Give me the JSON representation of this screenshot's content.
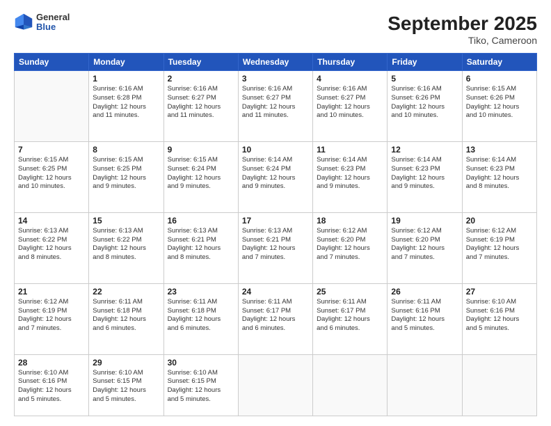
{
  "header": {
    "logo_general": "General",
    "logo_blue": "Blue",
    "month": "September 2025",
    "location": "Tiko, Cameroon"
  },
  "days_of_week": [
    "Sunday",
    "Monday",
    "Tuesday",
    "Wednesday",
    "Thursday",
    "Friday",
    "Saturday"
  ],
  "weeks": [
    [
      {
        "day": "",
        "text": ""
      },
      {
        "day": "1",
        "text": "Sunrise: 6:16 AM\nSunset: 6:28 PM\nDaylight: 12 hours\nand 11 minutes."
      },
      {
        "day": "2",
        "text": "Sunrise: 6:16 AM\nSunset: 6:27 PM\nDaylight: 12 hours\nand 11 minutes."
      },
      {
        "day": "3",
        "text": "Sunrise: 6:16 AM\nSunset: 6:27 PM\nDaylight: 12 hours\nand 11 minutes."
      },
      {
        "day": "4",
        "text": "Sunrise: 6:16 AM\nSunset: 6:27 PM\nDaylight: 12 hours\nand 10 minutes."
      },
      {
        "day": "5",
        "text": "Sunrise: 6:16 AM\nSunset: 6:26 PM\nDaylight: 12 hours\nand 10 minutes."
      },
      {
        "day": "6",
        "text": "Sunrise: 6:15 AM\nSunset: 6:26 PM\nDaylight: 12 hours\nand 10 minutes."
      }
    ],
    [
      {
        "day": "7",
        "text": "Sunrise: 6:15 AM\nSunset: 6:25 PM\nDaylight: 12 hours\nand 10 minutes."
      },
      {
        "day": "8",
        "text": "Sunrise: 6:15 AM\nSunset: 6:25 PM\nDaylight: 12 hours\nand 9 minutes."
      },
      {
        "day": "9",
        "text": "Sunrise: 6:15 AM\nSunset: 6:24 PM\nDaylight: 12 hours\nand 9 minutes."
      },
      {
        "day": "10",
        "text": "Sunrise: 6:14 AM\nSunset: 6:24 PM\nDaylight: 12 hours\nand 9 minutes."
      },
      {
        "day": "11",
        "text": "Sunrise: 6:14 AM\nSunset: 6:23 PM\nDaylight: 12 hours\nand 9 minutes."
      },
      {
        "day": "12",
        "text": "Sunrise: 6:14 AM\nSunset: 6:23 PM\nDaylight: 12 hours\nand 9 minutes."
      },
      {
        "day": "13",
        "text": "Sunrise: 6:14 AM\nSunset: 6:23 PM\nDaylight: 12 hours\nand 8 minutes."
      }
    ],
    [
      {
        "day": "14",
        "text": "Sunrise: 6:13 AM\nSunset: 6:22 PM\nDaylight: 12 hours\nand 8 minutes."
      },
      {
        "day": "15",
        "text": "Sunrise: 6:13 AM\nSunset: 6:22 PM\nDaylight: 12 hours\nand 8 minutes."
      },
      {
        "day": "16",
        "text": "Sunrise: 6:13 AM\nSunset: 6:21 PM\nDaylight: 12 hours\nand 8 minutes."
      },
      {
        "day": "17",
        "text": "Sunrise: 6:13 AM\nSunset: 6:21 PM\nDaylight: 12 hours\nand 7 minutes."
      },
      {
        "day": "18",
        "text": "Sunrise: 6:12 AM\nSunset: 6:20 PM\nDaylight: 12 hours\nand 7 minutes."
      },
      {
        "day": "19",
        "text": "Sunrise: 6:12 AM\nSunset: 6:20 PM\nDaylight: 12 hours\nand 7 minutes."
      },
      {
        "day": "20",
        "text": "Sunrise: 6:12 AM\nSunset: 6:19 PM\nDaylight: 12 hours\nand 7 minutes."
      }
    ],
    [
      {
        "day": "21",
        "text": "Sunrise: 6:12 AM\nSunset: 6:19 PM\nDaylight: 12 hours\nand 7 minutes."
      },
      {
        "day": "22",
        "text": "Sunrise: 6:11 AM\nSunset: 6:18 PM\nDaylight: 12 hours\nand 6 minutes."
      },
      {
        "day": "23",
        "text": "Sunrise: 6:11 AM\nSunset: 6:18 PM\nDaylight: 12 hours\nand 6 minutes."
      },
      {
        "day": "24",
        "text": "Sunrise: 6:11 AM\nSunset: 6:17 PM\nDaylight: 12 hours\nand 6 minutes."
      },
      {
        "day": "25",
        "text": "Sunrise: 6:11 AM\nSunset: 6:17 PM\nDaylight: 12 hours\nand 6 minutes."
      },
      {
        "day": "26",
        "text": "Sunrise: 6:11 AM\nSunset: 6:16 PM\nDaylight: 12 hours\nand 5 minutes."
      },
      {
        "day": "27",
        "text": "Sunrise: 6:10 AM\nSunset: 6:16 PM\nDaylight: 12 hours\nand 5 minutes."
      }
    ],
    [
      {
        "day": "28",
        "text": "Sunrise: 6:10 AM\nSunset: 6:16 PM\nDaylight: 12 hours\nand 5 minutes."
      },
      {
        "day": "29",
        "text": "Sunrise: 6:10 AM\nSunset: 6:15 PM\nDaylight: 12 hours\nand 5 minutes."
      },
      {
        "day": "30",
        "text": "Sunrise: 6:10 AM\nSunset: 6:15 PM\nDaylight: 12 hours\nand 5 minutes."
      },
      {
        "day": "",
        "text": ""
      },
      {
        "day": "",
        "text": ""
      },
      {
        "day": "",
        "text": ""
      },
      {
        "day": "",
        "text": ""
      }
    ]
  ]
}
